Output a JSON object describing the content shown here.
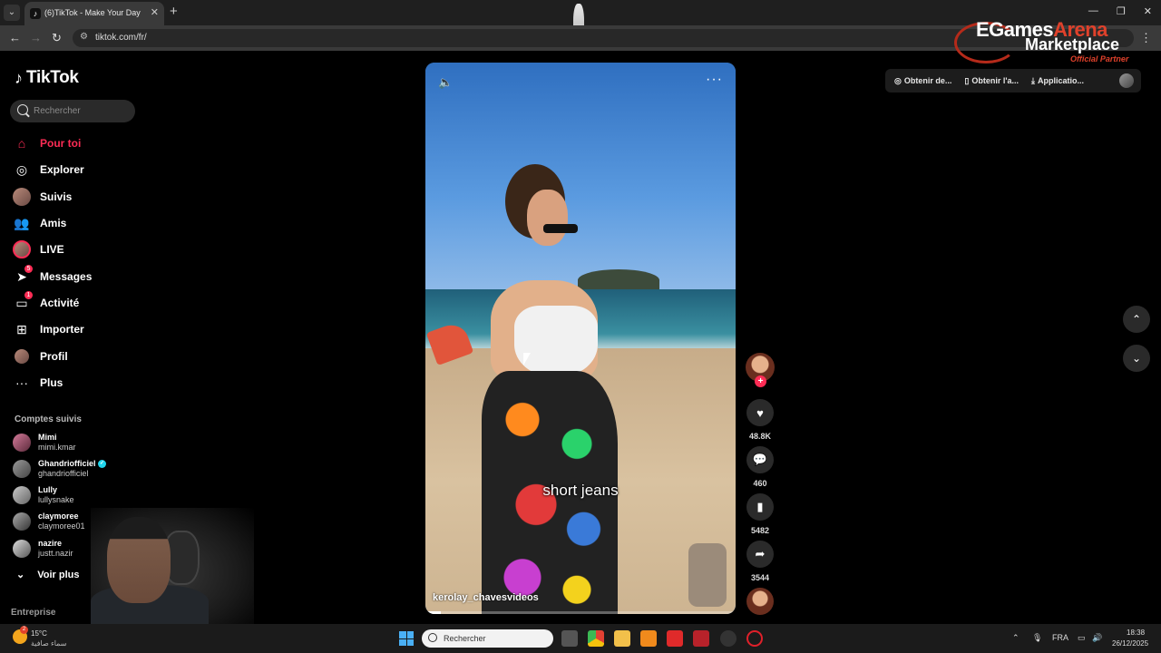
{
  "browser": {
    "tab_title": "(6)TikTok - Make Your Day",
    "tab_close": "✕",
    "new_tab": "+",
    "url": "tiktok.com/fr/",
    "window_controls": [
      "—",
      "❐",
      "✕"
    ]
  },
  "watermark": {
    "brand_white": "EGames",
    "brand_red": "Arena",
    "line2": "Marketplace",
    "tagline": "Official Partner"
  },
  "sidebar": {
    "logo_text": "TikTok",
    "search_placeholder": "Rechercher",
    "nav": [
      {
        "label": "Pour toi",
        "icon": "home-icon",
        "active": true
      },
      {
        "label": "Explorer",
        "icon": "compass-icon"
      },
      {
        "label": "Suivis",
        "icon": "avatar-icon"
      },
      {
        "label": "Amis",
        "icon": "friends-icon"
      },
      {
        "label": "LIVE",
        "icon": "live-avatar-icon"
      },
      {
        "label": "Messages",
        "icon": "send-icon",
        "badge": "5"
      },
      {
        "label": "Activité",
        "icon": "inbox-icon",
        "badge": "1"
      },
      {
        "label": "Importer",
        "icon": "plus-square-icon"
      },
      {
        "label": "Profil",
        "icon": "profile-avatar-icon"
      },
      {
        "label": "Plus",
        "icon": "more-icon"
      }
    ],
    "following_title": "Comptes suivis",
    "following": [
      {
        "name": "Mimi",
        "handle": "mimi.kmar"
      },
      {
        "name": "Ghandriofficiel",
        "handle": "ghandriofficiel",
        "verified": true
      },
      {
        "name": "Lully",
        "handle": "lullysnake"
      },
      {
        "name": "claymoree",
        "handle": "claymoree01"
      },
      {
        "name": "nazire",
        "handle": "justt.nazir"
      }
    ],
    "see_more": "Voir plus",
    "footer": "Entreprise"
  },
  "video": {
    "caption": "short jeans",
    "author": "kerolay_chavesvideos",
    "progress": 0.05
  },
  "actions": {
    "likes": "48.8K",
    "comments": "460",
    "saves": "5482",
    "shares": "3544"
  },
  "header_links": [
    {
      "label": "Obtenir de...",
      "icon": "coin-icon"
    },
    {
      "label": "Obtenir l'a...",
      "icon": "phone-icon"
    },
    {
      "label": "Applicatio...",
      "icon": "download-icon"
    }
  ],
  "taskbar": {
    "weather_temp": "15°C",
    "weather_desc": "سماء صافية",
    "weather_badge": "2",
    "search_placeholder": "Rechercher",
    "language": "FRA",
    "time": "18:38",
    "date": "26/12/2025"
  }
}
